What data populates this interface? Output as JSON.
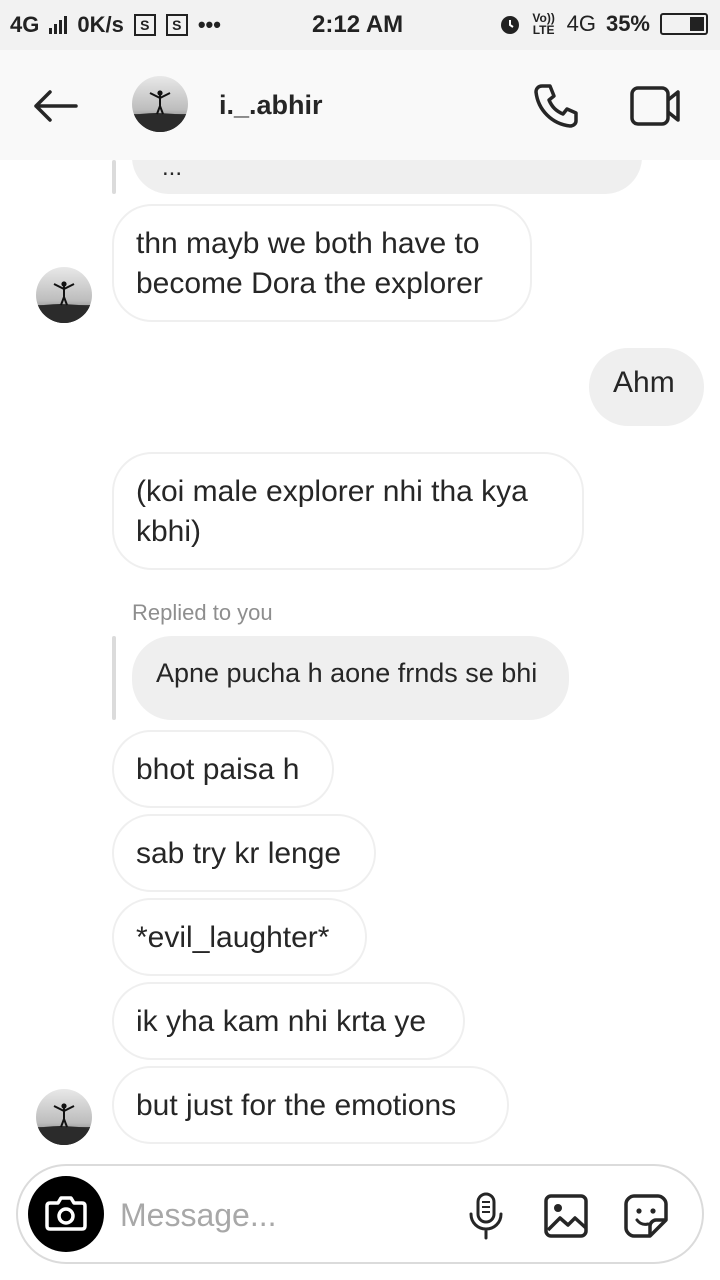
{
  "status_bar": {
    "network_left": "4G",
    "speed": "0K/s",
    "sim1": "S",
    "sim2": "S",
    "dots": "•••",
    "time": "2:12 AM",
    "volte": "Vo)) LTE",
    "network_right": "4G",
    "battery": "35%",
    "battery_level": 0.35
  },
  "header": {
    "username": "i._.abhir",
    "back_icon": "arrow-left-icon",
    "call_icon": "phone-icon",
    "video_icon": "video-camera-icon"
  },
  "messages": {
    "partial_top": "...",
    "m1": "thn mayb we both have to become Dora the explorer",
    "m2_out": "Ahm",
    "m3": "(koi male explorer nhi tha kya kbhi)",
    "replied_label": "Replied to you",
    "reply_quote": "Apne pucha h aone frnds se bhi",
    "m4": "bhot paisa h",
    "m5": "sab try kr lenge",
    "m6": "*evil_laughter*",
    "m7": "ik yha kam nhi krta ye",
    "m8": "but just for the emotions"
  },
  "composer": {
    "placeholder": "Message...",
    "camera_icon": "camera-icon",
    "mic_icon": "microphone-icon",
    "gallery_icon": "image-icon",
    "sticker_icon": "sticker-icon"
  }
}
